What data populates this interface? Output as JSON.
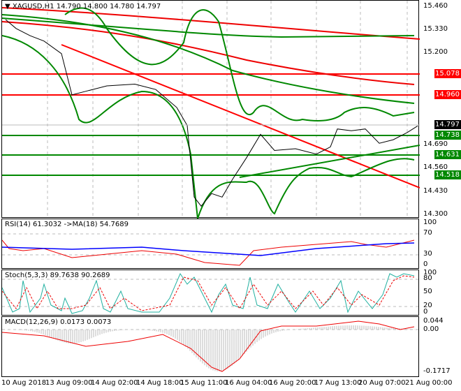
{
  "header": {
    "symbol": "XAGUSD,H1",
    "ohlc": "14.790 14.800 14.780 14.797"
  },
  "price_axis": {
    "ticks": [
      "15.460",
      "15.330",
      "15.200",
      "14.690",
      "14.560",
      "14.430",
      "14.300"
    ],
    "levels": [
      {
        "value": "15.078",
        "color": "#ff0000"
      },
      {
        "value": "14.960",
        "color": "#ff0000"
      },
      {
        "value": "14.797",
        "color": "#000000"
      },
      {
        "value": "14.738",
        "color": "#008000"
      },
      {
        "value": "14.631",
        "color": "#008000"
      },
      {
        "value": "14.518",
        "color": "#008000"
      }
    ]
  },
  "rsi": {
    "title": "RSI(14) 61.3032  ->MA(18) 54.7689",
    "ticks": [
      "100",
      "70",
      "30",
      "0"
    ]
  },
  "stoch": {
    "title": "Stoch(5,3,3) 89.7638 90.2689",
    "ticks": [
      "100",
      "80",
      "50",
      "20",
      "0"
    ]
  },
  "macd": {
    "title": "MACD(12,26,9) 0.0173 0.0073",
    "ticks": [
      "0.044",
      "0.00",
      "-0.1717"
    ]
  },
  "time_axis": [
    "10 Aug 2018",
    "13 Aug 09:00",
    "14 Aug 02:00",
    "14 Aug 18:00",
    "15 Aug 11:00",
    "16 Aug 04:00",
    "16 Aug 20:00",
    "17 Aug 13:00",
    "20 Aug 07:00",
    "21 Aug 00:00"
  ],
  "price_series": [
    [
      5,
      15.39
    ],
    [
      20,
      15.34
    ],
    [
      40,
      15.3
    ],
    [
      60,
      15.27
    ],
    [
      85,
      15.2
    ],
    [
      100,
      14.97
    ],
    [
      120,
      14.99
    ],
    [
      150,
      15.02
    ],
    [
      190,
      15.03
    ],
    [
      220,
      15.0
    ],
    [
      250,
      14.9
    ],
    [
      265,
      14.8
    ],
    [
      275,
      14.4
    ],
    [
      285,
      14.35
    ],
    [
      300,
      14.42
    ],
    [
      315,
      14.4
    ],
    [
      330,
      14.5
    ],
    [
      350,
      14.62
    ],
    [
      370,
      14.75
    ],
    [
      390,
      14.66
    ],
    [
      420,
      14.67
    ],
    [
      450,
      14.64
    ],
    [
      470,
      14.68
    ],
    [
      480,
      14.78
    ],
    [
      500,
      14.77
    ],
    [
      520,
      14.78
    ],
    [
      540,
      14.7
    ],
    [
      560,
      14.72
    ],
    [
      580,
      14.76
    ],
    [
      595,
      14.797
    ]
  ]
}
